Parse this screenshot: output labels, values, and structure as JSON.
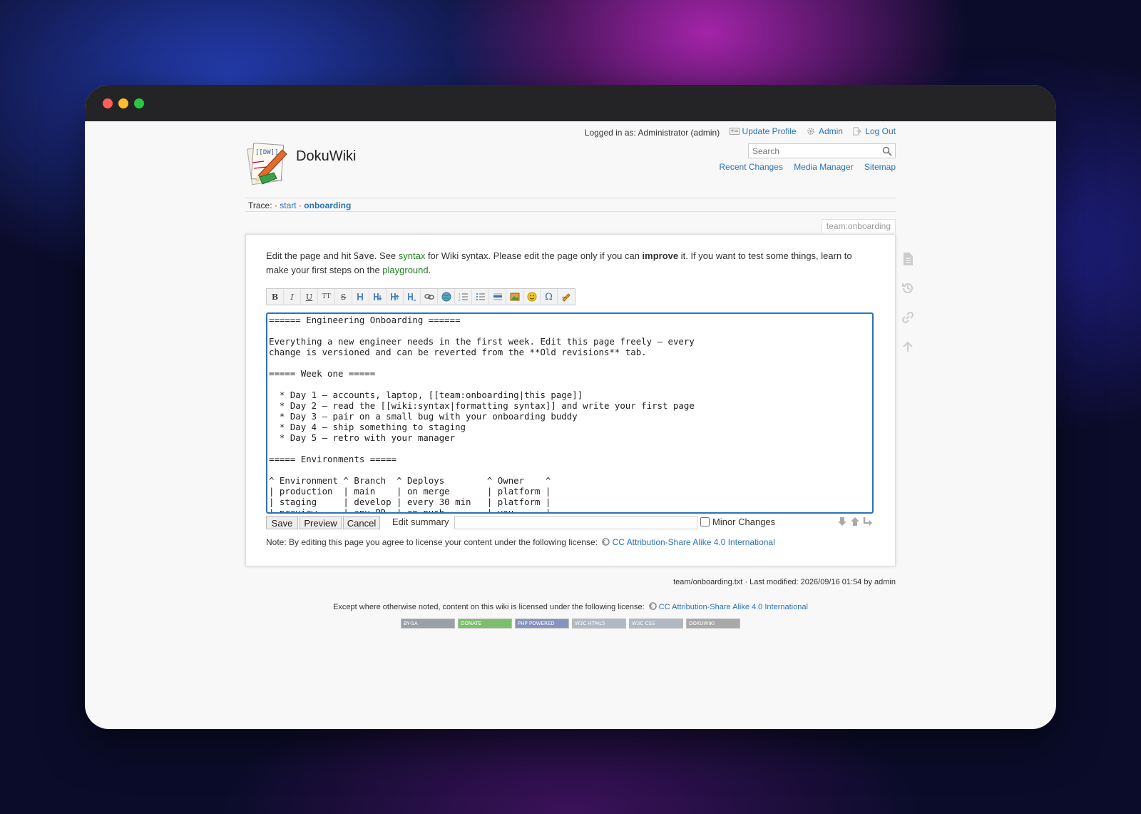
{
  "usertools": {
    "logged_in": "Logged in as: Administrator (admin)",
    "update_profile": "Update Profile",
    "admin": "Admin",
    "logout": "Log Out"
  },
  "site": {
    "title": "DokuWiki"
  },
  "search": {
    "placeholder": "Search"
  },
  "sitetools": {
    "recent": "Recent Changes",
    "media": "Media Manager",
    "sitemap": "Sitemap"
  },
  "trace": {
    "label": "Trace:",
    "sep1": "·",
    "start": "start",
    "sep2": "·",
    "current": "onboarding"
  },
  "pageid": "team:onboarding",
  "intro": {
    "t1": "Edit the page and hit ",
    "code": "Save",
    "t2": ". See ",
    "syntax": "syntax",
    "t3": " for Wiki syntax. Please edit the page only if you can ",
    "improve": "improve",
    "t4": " it. If you want to test some things, learn to make your first steps on the ",
    "playground": "playground",
    "t5": "."
  },
  "toolbar": [
    "B",
    "I",
    "U",
    "TT",
    "S",
    "H",
    "H",
    "H",
    "H",
    "link",
    "globe",
    "ol",
    "ul",
    "hr",
    "img",
    "smiley",
    "Ω",
    "sig"
  ],
  "editor": {
    "text": "====== Engineering Onboarding ======\n\nEverything a new engineer needs in the first week. Edit this page freely — every\nchange is versioned and can be reverted from the **Old revisions** tab.\n\n===== Week one =====\n\n  * Day 1 — accounts, laptop, [[team:onboarding|this page]]\n  * Day 2 — read the [[wiki:syntax|formatting syntax]] and write your first page\n  * Day 3 — pair on a small bug with your onboarding buddy\n  * Day 4 — ship something to staging\n  * Day 5 — retro with your manager\n\n===== Environments =====\n\n^ Environment ^ Branch  ^ Deploys        ^ Owner    ^\n| production  | main    | on merge       | platform |\n| staging     | develop | every 30 min   | platform |\n| preview     | any PR  | on push        | you      |"
  },
  "editbar": {
    "save": "Save",
    "preview": "Preview",
    "cancel": "Cancel",
    "summary_label": "Edit summary",
    "minor": "Minor Changes"
  },
  "license_note": {
    "text": "Note: By editing this page you agree to license your content under the following license:",
    "license": "CC Attribution-Share Alike 4.0 International"
  },
  "pageinfo": "team/onboarding.txt · Last modified: 2026/09/16 01:54 by admin",
  "footer": {
    "text": "Except where otherwise noted, content on this wiki is licensed under the following license:",
    "license": "CC Attribution-Share Alike 4.0 International"
  },
  "badges": [
    {
      "label": "BY-SA",
      "color": "#9aa0a6"
    },
    {
      "label": "DONATE",
      "color": "#7bbf6a"
    },
    {
      "label": "PHP POWERED",
      "color": "#8892bf"
    },
    {
      "label": "W3C HTML5",
      "color": "#b0b8c4"
    },
    {
      "label": "W3C CSS",
      "color": "#b0b8c4"
    },
    {
      "label": "DOKUWIKI",
      "color": "#a8a8a8"
    }
  ]
}
